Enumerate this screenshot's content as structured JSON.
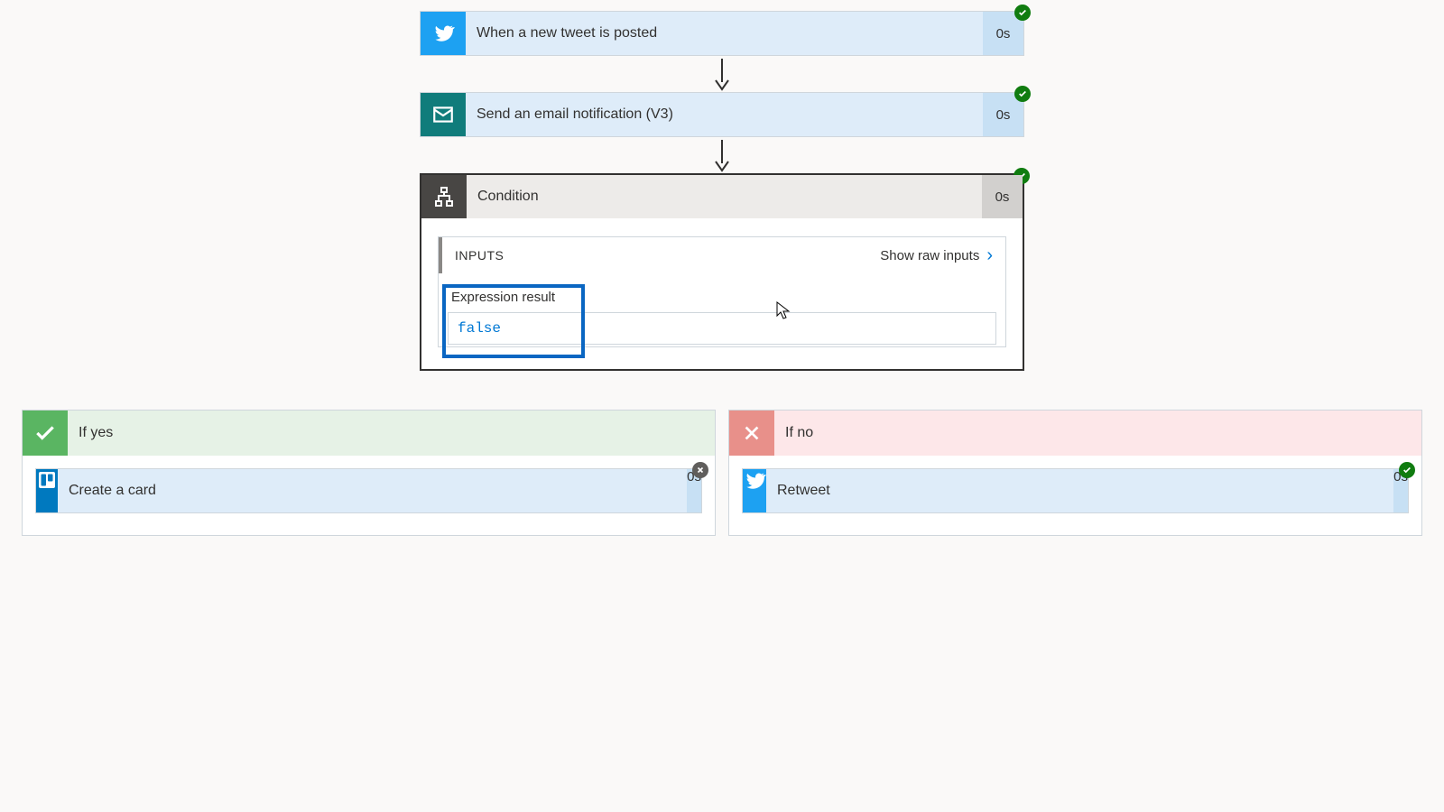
{
  "trigger": {
    "label": "When a new tweet is posted",
    "duration": "0s",
    "status": "success"
  },
  "email_step": {
    "label": "Send an email notification (V3)",
    "duration": "0s",
    "status": "success"
  },
  "condition": {
    "label": "Condition",
    "duration": "0s",
    "status": "success",
    "inputs_heading": "INPUTS",
    "show_raw_label": "Show raw inputs",
    "expression_label": "Expression result",
    "expression_value": "false"
  },
  "branches": {
    "yes": {
      "heading": "If yes",
      "action": {
        "label": "Create a card",
        "duration": "0s",
        "status": "skipped"
      }
    },
    "no": {
      "heading": "If no",
      "action": {
        "label": "Retweet",
        "duration": "0s",
        "status": "success"
      }
    }
  }
}
